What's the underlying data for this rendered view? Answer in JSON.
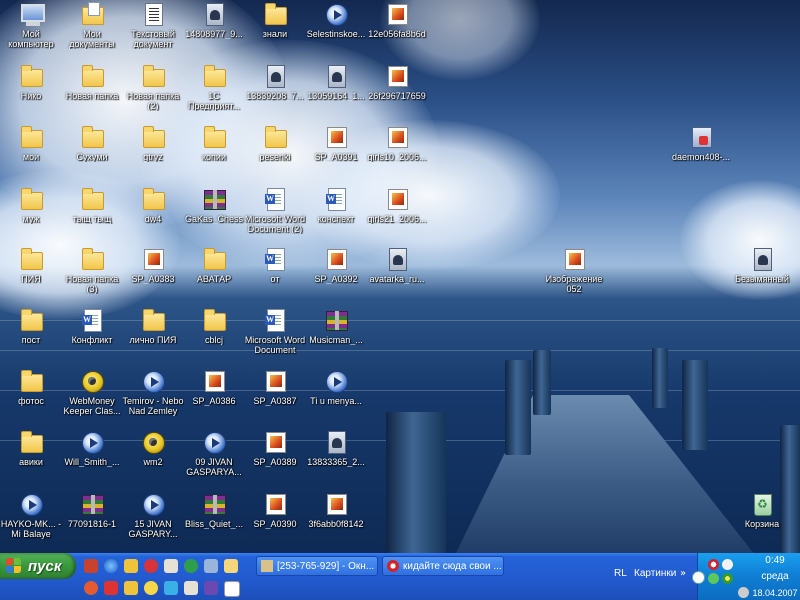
{
  "desktop": {
    "icons": [
      {
        "label": "Мой компьютер",
        "type": "computer"
      },
      {
        "label": "Мои документы",
        "type": "mydocs"
      },
      {
        "label": "Текстовый документ",
        "type": "textdoc"
      },
      {
        "label": "14808977_9...",
        "type": "dark"
      },
      {
        "label": "знали",
        "type": "folder"
      },
      {
        "label": "Selestinskoe...",
        "type": "wmp"
      },
      {
        "label": "12e056fa8b6d",
        "type": "img"
      },
      {
        "label": "Нико",
        "type": "folder"
      },
      {
        "label": "Новая папка",
        "type": "folder"
      },
      {
        "label": "Новая папка (2)",
        "type": "folder"
      },
      {
        "label": "1С Предприят...",
        "type": "folder"
      },
      {
        "label": "13839208_7...",
        "type": "dark"
      },
      {
        "label": "13059164_1...",
        "type": "dark"
      },
      {
        "label": "26f296717659",
        "type": "img"
      },
      {
        "label": "мои",
        "type": "folder"
      },
      {
        "label": "Сухуми",
        "type": "folder"
      },
      {
        "label": "gtryz",
        "type": "folder"
      },
      {
        "label": "копии",
        "type": "folder"
      },
      {
        "label": "pesenki",
        "type": "folder"
      },
      {
        "label": "SP_A0391",
        "type": "img"
      },
      {
        "label": "girls10_2006...",
        "type": "img"
      },
      {
        "label": "daemon408-...",
        "type": "setup"
      },
      {
        "label": "муж",
        "type": "folder"
      },
      {
        "label": "тыщ тыщ",
        "type": "folder"
      },
      {
        "label": "dw4",
        "type": "folder"
      },
      {
        "label": "GaKas_Chess",
        "type": "rar"
      },
      {
        "label": "Microsoft Word Document (2)",
        "type": "word"
      },
      {
        "label": "конспект",
        "type": "word"
      },
      {
        "label": "girls21_2006...",
        "type": "img"
      },
      {
        "label": "ПИЯ",
        "type": "folder"
      },
      {
        "label": "Новая папка (3)",
        "type": "folder"
      },
      {
        "label": "SP_A0383",
        "type": "img"
      },
      {
        "label": "АВАТАР",
        "type": "folder"
      },
      {
        "label": "от",
        "type": "word"
      },
      {
        "label": "SP_A0392",
        "type": "img"
      },
      {
        "label": "avatarka_ru...",
        "type": "dark"
      },
      {
        "label": "Изображение 052",
        "type": "img"
      },
      {
        "label": "Безымянный",
        "type": "dark"
      },
      {
        "label": "пост",
        "type": "folder"
      },
      {
        "label": "Конфликт",
        "type": "word"
      },
      {
        "label": "лично ПИЯ",
        "type": "folder"
      },
      {
        "label": "cblcj",
        "type": "folder"
      },
      {
        "label": "Microsoft Word Document",
        "type": "word"
      },
      {
        "label": "Musicman_...",
        "type": "rar"
      },
      {
        "label": "фотос",
        "type": "folder"
      },
      {
        "label": "WebMoney Keeper Clas...",
        "type": "webm"
      },
      {
        "label": "Temirov - Nebo Nad Zemley",
        "type": "wmp"
      },
      {
        "label": "SP_A0386",
        "type": "img"
      },
      {
        "label": "SP_A0387",
        "type": "img"
      },
      {
        "label": "Ti u menya...",
        "type": "wmp"
      },
      {
        "label": "авики",
        "type": "folder"
      },
      {
        "label": "Will_Smith_...",
        "type": "wmp"
      },
      {
        "label": "wm2",
        "type": "webm"
      },
      {
        "label": "09 JIVAN GASPARYA...",
        "type": "wmp"
      },
      {
        "label": "SP_A0389",
        "type": "img"
      },
      {
        "label": "13833365_2...",
        "type": "dark"
      },
      {
        "label": "HAYKO-MK... - Mi Balaye",
        "type": "wmp"
      },
      {
        "label": "77091816-1",
        "type": "rar"
      },
      {
        "label": "15 JIVAN GASPARY...",
        "type": "wmp"
      },
      {
        "label": "Bliss_Quiet_...",
        "type": "rar"
      },
      {
        "label": "SP_A0390",
        "type": "img"
      },
      {
        "label": "3f6abb0f8142",
        "type": "img"
      },
      {
        "label": "Корзина",
        "type": "recycle"
      }
    ]
  },
  "taskbar": {
    "start_label": "пуск",
    "tasks": [
      {
        "label": "[253-765-929] - Окн..."
      },
      {
        "label": "кидайте сюда свои ..."
      }
    ],
    "language": "RL",
    "pictures_label": "Картинки",
    "toolbar_arrow": "»",
    "clock": {
      "time": "0:49",
      "day": "среда",
      "date": "18.04.2007"
    }
  },
  "colors": {
    "taskbar": "#245edb",
    "start": "#3a9a3d",
    "tray": "#0f7ed3"
  }
}
